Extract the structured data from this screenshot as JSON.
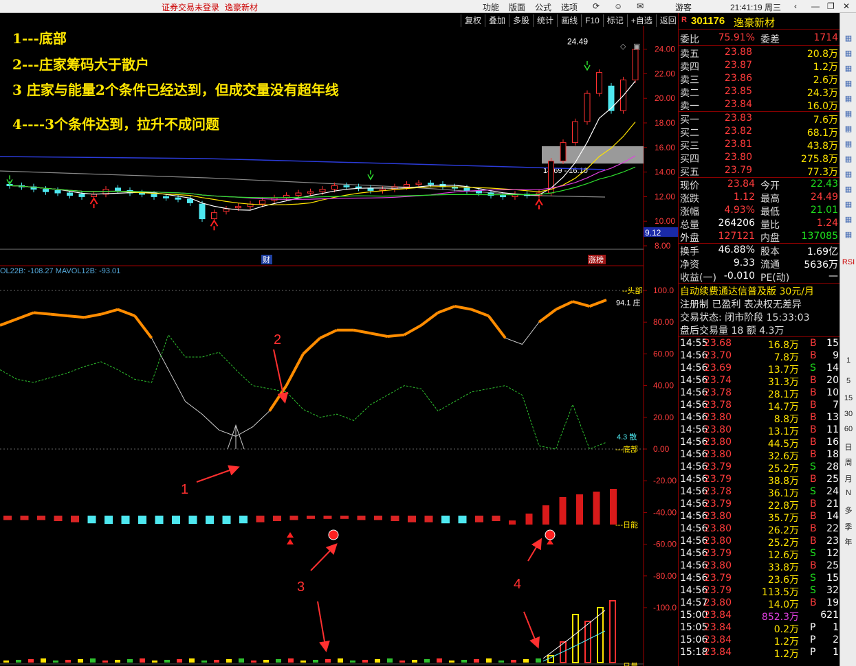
{
  "topbar": {
    "notice": "证券交易未登录",
    "stock": "逸豪新材",
    "menus": [
      "功能",
      "版面",
      "公式",
      "选项"
    ],
    "guest": "游客",
    "clock": "21:41:19 周三"
  },
  "toolbar": [
    "复权",
    "叠加",
    "多股",
    "统计",
    "画线",
    "F10",
    "标记",
    "+自选",
    "返回"
  ],
  "annotations": [
    "1---底部",
    "2---庄家筹码大于散户",
    "3 庄家与能量2个条件已经达到，但成交量没有超年线",
    "4----3个条件达到，拉升不成问题"
  ],
  "price_panel": {
    "axis_labels": [
      "24.00",
      "22.00",
      "20.00",
      "18.00",
      "16.00",
      "14.00",
      "12.00",
      "10.00",
      "8.00"
    ],
    "axis_values": [
      24,
      22,
      20,
      18,
      16,
      14,
      12,
      10,
      8
    ],
    "high_label": "24.49",
    "range_label": "14.69 - 16.10",
    "low_flag": "9.12",
    "tag_cai": "财",
    "tag_limit": "涨榜"
  },
  "indicator_panel": {
    "title": "OL22B: -108.27  MAVOL12B: -93.01",
    "axis_labels": [
      "100.0",
      "80.00",
      "60.00",
      "40.00",
      "20.00",
      "0.00",
      "-20.00",
      "-40.00",
      "-60.00",
      "-80.00",
      "-100.0"
    ],
    "axis_values": [
      100,
      80,
      60,
      40,
      20,
      0,
      -20,
      -40,
      -60,
      -80,
      -100
    ],
    "top_label": "头部",
    "zhuang_label": "94.1 庄",
    "san_label": "4.3  散",
    "bottom_label": "底部",
    "energy_label": "日能",
    "volume_label": "日量",
    "arrow_numbers": [
      "1",
      "2",
      "3",
      "4"
    ]
  },
  "chart_data": [
    {
      "type": "line",
      "title": "",
      "series": [
        {
          "name": "庄",
          "values": [
            78,
            82,
            86,
            85,
            84,
            83,
            85,
            88,
            84,
            70,
            50,
            30,
            22,
            12,
            8,
            14,
            24,
            40,
            60,
            70,
            75,
            75,
            73,
            71,
            72,
            78,
            86,
            90,
            88,
            84,
            70,
            66,
            80,
            88,
            93,
            90,
            94
          ]
        },
        {
          "name": "散",
          "values": [
            50,
            44,
            42,
            45,
            48,
            52,
            55,
            50,
            44,
            42,
            72,
            58,
            58,
            61,
            50,
            40,
            38,
            36,
            25,
            20,
            22,
            18,
            28,
            34,
            40,
            38,
            24,
            30,
            36,
            38,
            40,
            34,
            2,
            0,
            28,
            0,
            4.3
          ]
        }
      ],
      "ylim": [
        0,
        100
      ]
    },
    {
      "type": "bar",
      "title": "",
      "series": [
        {
          "name": "日能",
          "values": [
            -4,
            -4,
            -4,
            -5,
            -6,
            -7,
            -8,
            -8,
            -9,
            -9,
            -10,
            -10,
            -9,
            -8,
            -7,
            -6,
            -5,
            -4,
            -3,
            -3,
            -3,
            -4,
            -4,
            -5,
            -6,
            -6,
            -7,
            -7,
            -6,
            -5,
            3,
            8,
            14,
            20,
            22,
            24,
            26
          ]
        }
      ],
      "ylim": [
        -40,
        0
      ]
    }
  ],
  "quote": {
    "code": "301176",
    "name": "逸豪新材",
    "weibi_label": "委比",
    "weibi": "75.91%",
    "weicha_label": "委差",
    "weicha": "1714",
    "sells": [
      {
        "label": "卖五",
        "price": "23.88",
        "vol": "20.8万"
      },
      {
        "label": "卖四",
        "price": "23.87",
        "vol": "1.2万"
      },
      {
        "label": "卖三",
        "price": "23.86",
        "vol": "2.6万"
      },
      {
        "label": "卖二",
        "price": "23.85",
        "vol": "24.3万"
      },
      {
        "label": "卖一",
        "price": "23.84",
        "vol": "16.0万"
      }
    ],
    "buys": [
      {
        "label": "买一",
        "price": "23.83",
        "vol": "7.6万"
      },
      {
        "label": "买二",
        "price": "23.82",
        "vol": "68.1万"
      },
      {
        "label": "买三",
        "price": "23.81",
        "vol": "43.8万"
      },
      {
        "label": "买四",
        "price": "23.80",
        "vol": "275.8万"
      },
      {
        "label": "买五",
        "price": "23.79",
        "vol": "77.3万"
      }
    ],
    "stats": [
      {
        "l1": "现价",
        "v1": "23.84",
        "c1": "red",
        "l2": "今开",
        "v2": "22.43",
        "c2": "grn"
      },
      {
        "l1": "涨跌",
        "v1": "1.12",
        "c1": "red",
        "l2": "最高",
        "v2": "24.49",
        "c2": "red"
      },
      {
        "l1": "涨幅",
        "v1": "4.93%",
        "c1": "red",
        "l2": "最低",
        "v2": "21.01",
        "c2": "grn"
      },
      {
        "l1": "总量",
        "v1": "264206",
        "c1": "wht",
        "l2": "量比",
        "v2": "1.24",
        "c2": "red"
      },
      {
        "l1": "外盘",
        "v1": "127121",
        "c1": "red",
        "l2": "内盘",
        "v2": "137085",
        "c2": "grn"
      }
    ],
    "stats2": [
      {
        "l1": "换手",
        "v1": "46.88%",
        "l2": "股本",
        "v2": "1.69亿"
      },
      {
        "l1": "净资",
        "v1": "9.33",
        "l2": "流通",
        "v2": "5636万"
      },
      {
        "l1": "收益(一)",
        "v1": "-0.010",
        "l2": "PE(动)",
        "v2": "—"
      }
    ],
    "promo": "自动续费通达信普及版  30元/月",
    "promo2": "注册制 已盈利 表决权无差异",
    "status": "交易状态: 闭市阶段 15:33:03",
    "afterhours": "盘后交易量 18 额 4.3万",
    "ticks": [
      {
        "t": "14:55",
        "p": "23.68",
        "v": "16.8万",
        "s": "B",
        "n": "15"
      },
      {
        "t": "14:56",
        "p": "23.70",
        "v": "7.8万",
        "s": "B",
        "n": "9"
      },
      {
        "t": "14:56",
        "p": "23.69",
        "v": "13.7万",
        "s": "S",
        "n": "14"
      },
      {
        "t": "14:56",
        "p": "23.74",
        "v": "31.3万",
        "s": "B",
        "n": "20"
      },
      {
        "t": "14:56",
        "p": "23.78",
        "v": "28.1万",
        "s": "B",
        "n": "10"
      },
      {
        "t": "14:56",
        "p": "23.78",
        "v": "14.7万",
        "s": "B",
        "n": "7"
      },
      {
        "t": "14:56",
        "p": "23.80",
        "v": "8.8万",
        "s": "B",
        "n": "13"
      },
      {
        "t": "14:56",
        "p": "23.80",
        "v": "13.1万",
        "s": "B",
        "n": "11"
      },
      {
        "t": "14:56",
        "p": "23.80",
        "v": "44.5万",
        "s": "B",
        "n": "16"
      },
      {
        "t": "14:56",
        "p": "23.80",
        "v": "32.6万",
        "s": "B",
        "n": "18"
      },
      {
        "t": "14:56",
        "p": "23.79",
        "v": "25.2万",
        "s": "S",
        "n": "28"
      },
      {
        "t": "14:56",
        "p": "23.79",
        "v": "38.8万",
        "s": "B",
        "n": "25"
      },
      {
        "t": "14:56",
        "p": "23.78",
        "v": "36.1万",
        "s": "S",
        "n": "24"
      },
      {
        "t": "14:56",
        "p": "23.79",
        "v": "22.8万",
        "s": "B",
        "n": "21"
      },
      {
        "t": "14:56",
        "p": "23.80",
        "v": "35.7万",
        "s": "B",
        "n": "14"
      },
      {
        "t": "14:56",
        "p": "23.80",
        "v": "26.2万",
        "s": "B",
        "n": "22"
      },
      {
        "t": "14:56",
        "p": "23.80",
        "v": "25.2万",
        "s": "B",
        "n": "23"
      },
      {
        "t": "14:56",
        "p": "23.79",
        "v": "12.6万",
        "s": "S",
        "n": "12"
      },
      {
        "t": "14:56",
        "p": "23.80",
        "v": "33.8万",
        "s": "B",
        "n": "25"
      },
      {
        "t": "14:56",
        "p": "23.79",
        "v": "23.6万",
        "s": "S",
        "n": "15"
      },
      {
        "t": "14:56",
        "p": "23.79",
        "v": "113.5万",
        "s": "S",
        "n": "32"
      },
      {
        "t": "14:57",
        "p": "23.80",
        "v": "14.0万",
        "s": "B",
        "n": "19"
      },
      {
        "t": "15:00",
        "p": "23.84",
        "v": "852.3万",
        "s": "",
        "n": "621"
      },
      {
        "t": "15:05",
        "p": "23.84",
        "v": "0.2万",
        "s": "P",
        "n": "1"
      },
      {
        "t": "15:06",
        "p": "23.84",
        "v": "1.2万",
        "s": "P",
        "n": "2"
      },
      {
        "t": "15:18",
        "p": "23.84",
        "v": "1.2万",
        "s": "P",
        "n": "1"
      }
    ]
  },
  "sidebar": [
    "RSI",
    "1",
    "5",
    "15",
    "30",
    "60",
    "日",
    "周",
    "月",
    "N",
    "多",
    "季",
    "年"
  ]
}
